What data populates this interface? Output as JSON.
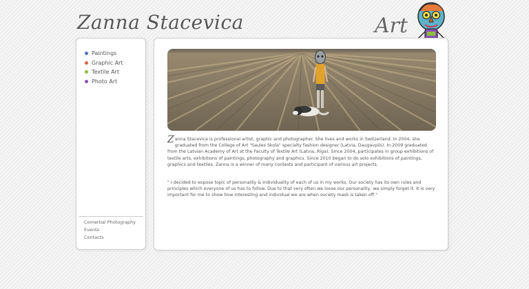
{
  "header": {
    "site_title": "Zanna Stacevica",
    "art_mark": "Art"
  },
  "nav": {
    "items": [
      {
        "label": "Paintings",
        "color": "#5a6fb8"
      },
      {
        "label": "Graphic Art",
        "color": "#d9643a"
      },
      {
        "label": "Textile Art",
        "color": "#8fbf3a"
      },
      {
        "label": "Photo Art",
        "color": "#8a4fb3"
      }
    ]
  },
  "secondary_nav": {
    "items": [
      {
        "label": "Comertial Photography"
      },
      {
        "label": "Events"
      },
      {
        "label": "Contacts"
      }
    ]
  },
  "content": {
    "bio_initial": "Z",
    "bio_rest": "anna Stacevica is professional artist, graphic and photographer. She lives and works in Switzerland. In 2004, she graduated from the College of Art \"Saules Skola\" specialty fashion designer (Latvia, Daugavpils). In 2009 graduated from the Latvian Academy of Art at the Faculty of Textile Art (Latvia, Riga). Since 2004, participates in group exhibitions of textile arts, exhibitions of paintings, photography and graphics. Since 2010 began to do solo exhibitions of paintings, graphics and textiles. Zanna is a winner of many contests and participant of various art projects.",
    "quote": "\" I decided to expose topic of personality & individuality of each of us in my works. Our society has its own rules and principles which everyone of us has to follow. Due to that very often we loose our personality, we simply forget it. It is very important for me to show how interesting and individual we are when society mask is taken off.\""
  }
}
